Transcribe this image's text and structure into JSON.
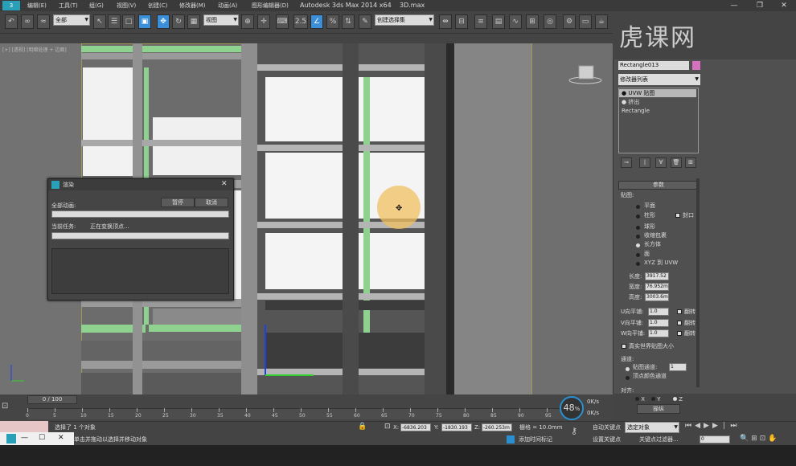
{
  "titlebar": {
    "app_logo": "3",
    "menus": [
      "编辑(E)",
      "工具(T)",
      "组(G)",
      "视图(V)",
      "创建(C)",
      "修改器(M)",
      "动画(A)",
      "图形编辑器(D)",
      "渲染(R)",
      "自定义(U)",
      "MAXScript(X)",
      "帮助(H)"
    ],
    "title": "Autodesk 3ds Max  2014 x64",
    "file": "3D.max",
    "win_min": "—",
    "win_restore": "❐",
    "win_close": "✕"
  },
  "toolbar": {
    "filter_select": "全部",
    "ref_coord": "视图",
    "snap_value": "2.5",
    "named_sel": "创建选择集"
  },
  "viewport": {
    "label": "[+] [透视] [明暗处理 + 边面]"
  },
  "watermark": "虎课网",
  "command_panel": {
    "object_name": "Rectangle013",
    "object_color": "#d870c0",
    "modifier_list": "修改器列表",
    "stack": [
      "UVW 贴图",
      "挤出",
      "Rectangle"
    ],
    "rollout": "参数",
    "mapping_label": "贴图:",
    "mapping_options": [
      "平面",
      "柱形",
      "球形",
      "收缩包裹",
      "长方体",
      "面",
      "XYZ 到 UVW"
    ],
    "cap_label": "封口",
    "length_label": "长度:",
    "length_value": "3917.52",
    "width_label": "宽度:",
    "width_value": "76.952m",
    "height_label": "高度:",
    "height_value": "3003.6m",
    "u_tile_label": "U向平铺:",
    "u_tile": "1.0",
    "v_tile_label": "V向平铺:",
    "v_tile": "1.0",
    "w_tile_label": "W向平铺:",
    "w_tile": "1.0",
    "flip_label": "翻转",
    "real_world": "真实世界贴图大小",
    "channel_label": "通道:",
    "map_channel": "贴图通道:",
    "map_channel_value": "1",
    "vertex_color": "顶点颜色通道",
    "align_label": "对齐:",
    "align_x": "X",
    "align_y": "Y",
    "align_z": "Z",
    "manipulate": "操纵"
  },
  "dialog": {
    "title": "渲染",
    "total_label": "全部动画:",
    "pause": "暂停",
    "cancel": "取消",
    "current_label": "当前任务:",
    "current_value": "正在变换顶点..."
  },
  "timeline": {
    "slider": "0 / 100",
    "ticks": [
      "0",
      "5",
      "10",
      "15",
      "20",
      "25",
      "30",
      "35",
      "40",
      "45",
      "50",
      "55",
      "60",
      "65",
      "70",
      "75",
      "80",
      "85",
      "90",
      "95"
    ]
  },
  "status": {
    "selected": "选择了 1 个对象",
    "hint": "单击并拖动以选择并移动对象",
    "x_label": "X:",
    "x_value": "-6836.203",
    "y_label": "Y:",
    "y_value": "-1830.193",
    "z_label": "Z:",
    "z_value": "-260.253m",
    "grid": "栅格 = 10.0mm",
    "add_time_tag": "添加时间标记",
    "auto_key": "自动关键点",
    "set_key": "设置关键点",
    "selected_obj": "选定对象",
    "key_filter": "关键点过滤器...",
    "frame": "0",
    "fps_badge": "48",
    "fps_unit": "%",
    "speed_top": "0K/s",
    "speed_bottom": "0K/s"
  },
  "mini_window": {
    "min": "—",
    "max": "☐",
    "close": "✕"
  }
}
